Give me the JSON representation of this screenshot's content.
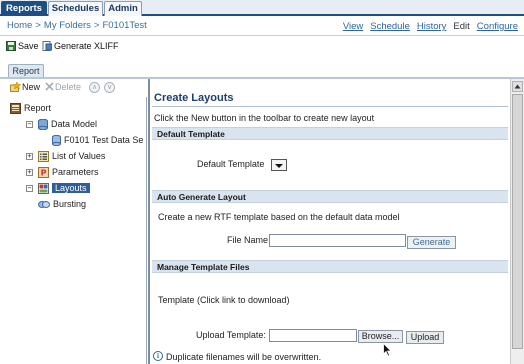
{
  "top_tabs": [
    {
      "label": "Reports",
      "active": true
    },
    {
      "label": "Schedules",
      "active": false
    },
    {
      "label": "Admin",
      "active": false
    }
  ],
  "breadcrumb": {
    "items": [
      "Home",
      "My Folders",
      "F0101Test"
    ],
    "separator": ">"
  },
  "top_links": {
    "view": "View",
    "schedule": "Schedule",
    "history": "History",
    "edit": "Edit",
    "configure": "Configure"
  },
  "toolbar": {
    "save_label": "Save",
    "generate_xliff_label": "Generate XLIFF"
  },
  "report_tab": {
    "label": "Report"
  },
  "left_toolbar": {
    "new_label": "New",
    "delete_label": "Delete"
  },
  "tree": {
    "root": "Report",
    "data_model": "Data Model",
    "data_set": "F0101 Test Data Se",
    "list_of_values": "List of Values",
    "parameters": "Parameters",
    "layouts": "Layouts",
    "bursting": "Bursting"
  },
  "main": {
    "title": "Create Layouts",
    "intro": "Click the New button in the toolbar to create new layout",
    "default_template": {
      "header": "Default Template",
      "label": "Default Template",
      "selected_value": ""
    },
    "auto_generate": {
      "header": "Auto Generate Layout",
      "description": "Create a new RTF template based on the default data model",
      "file_name_label": "File Name",
      "file_name_value": "",
      "generate_label": "Generate"
    },
    "manage_files": {
      "header": "Manage Template Files",
      "template_label": "Template (Click link to download)",
      "upload_label": "Upload Template:",
      "upload_value": "",
      "browse_label": "Browse...",
      "upload_button_label": "Upload",
      "info_text": "Duplicate filenames will be overwritten."
    }
  },
  "colors": {
    "accent": "#1d4f86",
    "link": "#2d64a5",
    "band": "#d9e4ef",
    "selected": "#2e5f99"
  }
}
